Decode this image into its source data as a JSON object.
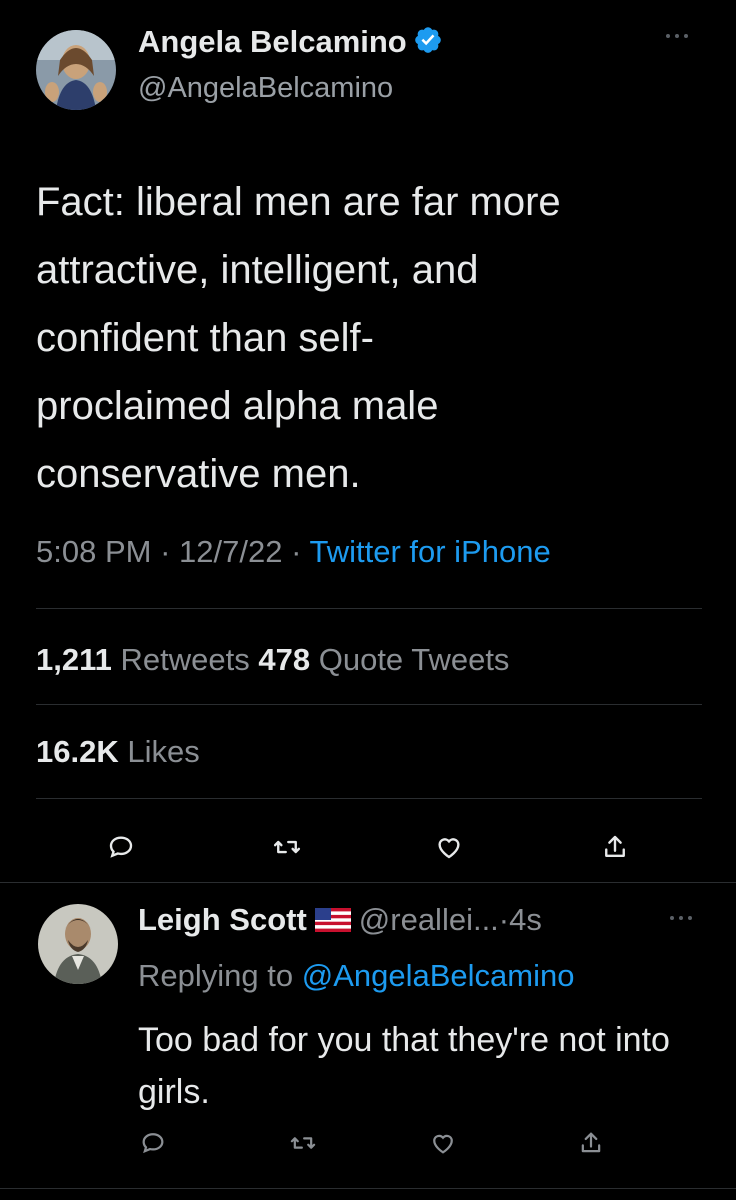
{
  "tweet": {
    "display_name": "Angela Belcamino",
    "handle": "@AngelaBelcamino",
    "text": "Fact: liberal men are far more\nattractive, intelligent, and\nconfident than self-\nproclaimed alpha male\nconservative men.",
    "time": "5:08 PM",
    "date": "12/7/22",
    "source": "Twitter for iPhone",
    "separator": "·",
    "retweets_count": "1,211",
    "retweets_label": "Retweets",
    "quotes_count": "478",
    "quotes_label": "Quote Tweets",
    "likes_count": "16.2K",
    "likes_label": "Likes",
    "verified": true
  },
  "reply": {
    "display_name": "Leigh Scott",
    "handle": "@reallei...",
    "time": "·4s",
    "replying_prefix": "Replying to",
    "replying_to": "@AngelaBelcamino",
    "text": "Too bad for you that they're not into girls."
  },
  "icons": {
    "actions": [
      "reply-icon",
      "retweet-icon",
      "like-icon",
      "share-icon"
    ],
    "more": "more-icon",
    "verified": "verified-badge-icon",
    "flag": "us-flag-icon"
  },
  "colors": {
    "background": "#000000",
    "text": "#e7e9ea",
    "secondary": "#8b8f94",
    "accent": "#1d9bf0",
    "divider": "#2a2d30"
  }
}
